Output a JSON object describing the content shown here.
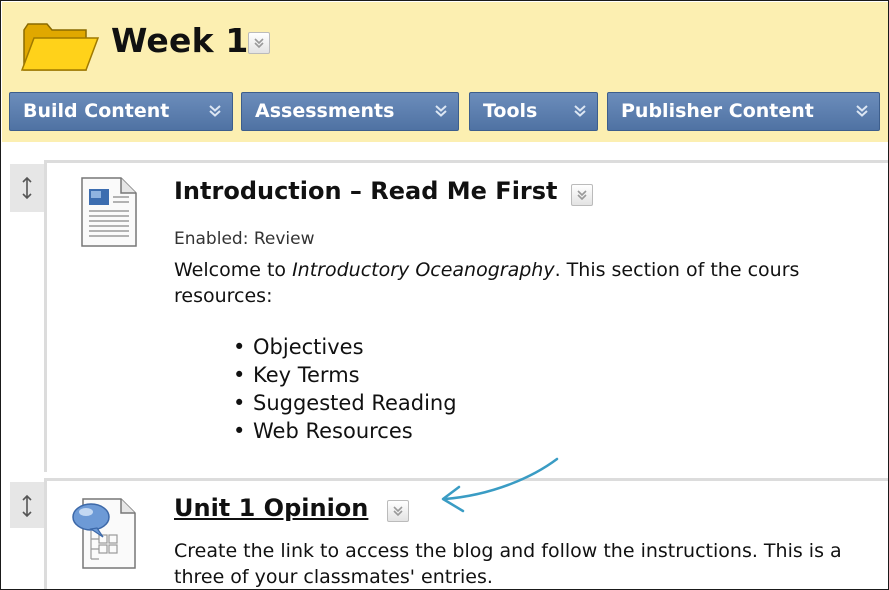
{
  "header": {
    "title": "Week 1"
  },
  "toolbar": {
    "build_content": "Build Content",
    "assessments": "Assessments",
    "tools": "Tools",
    "publisher_content": "Publisher Content"
  },
  "items": [
    {
      "title": "Introduction – Read Me First",
      "meta": "Enabled:  Review",
      "desc_prefix": "Welcome to ",
      "desc_em": "Introductory Oceanography",
      "desc_suffix": ". This section of the cours",
      "desc_line2": "resources:",
      "bullets": [
        "Objectives",
        "Key Terms",
        "Suggested Reading",
        "Web Resources"
      ]
    },
    {
      "title": "Unit 1 Opinion",
      "desc_line1": "Create the link to access the blog and follow the instructions. This is a",
      "desc_line2": "three of your classmates' entries."
    }
  ],
  "colors": {
    "header_bg": "#fcefb1",
    "toolbar_blue": "#5b7fb0",
    "annotation_arrow": "#3a9cc4"
  }
}
